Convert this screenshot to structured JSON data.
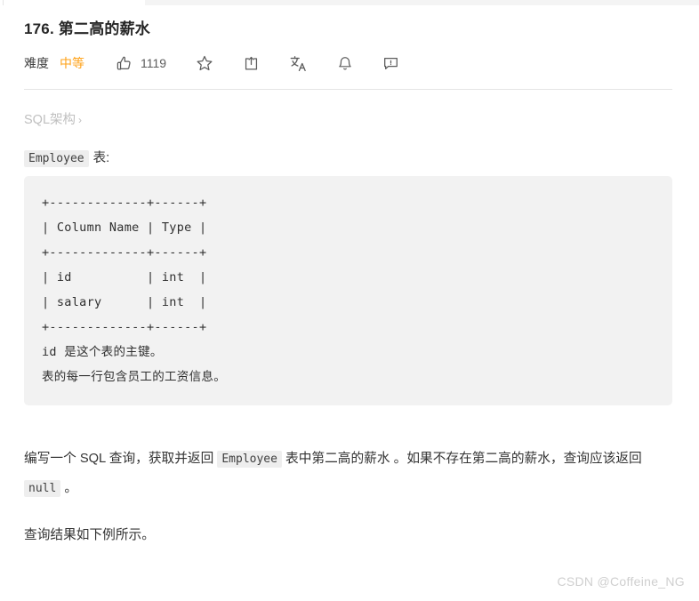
{
  "problem": {
    "title": "176. 第二高的薪水",
    "difficulty_label": "难度",
    "difficulty_value": "中等",
    "difficulty_color": "#ffa116"
  },
  "actions": {
    "like": {
      "icon": "thumbs-up-icon",
      "count": "1119"
    },
    "favorite": {
      "icon": "star-icon"
    },
    "share": {
      "icon": "share-icon"
    },
    "translate": {
      "icon": "translate-icon"
    },
    "notify": {
      "icon": "bell-icon"
    },
    "feedback": {
      "icon": "feedback-icon"
    }
  },
  "breadcrumb": {
    "label": "SQL架构",
    "chevron": "›"
  },
  "schema": {
    "code_name": "Employee",
    "caption_suffix": "表:",
    "ascii_table": "+-------------+------+\n| Column Name | Type |\n+-------------+------+\n| id          | int  |\n| salary      | int  |\n+-------------+------+",
    "notes": [
      "id 是这个表的主键。",
      "表的每一行包含员工的工资信息。"
    ]
  },
  "description": {
    "part1": "编写一个 SQL 查询，获取并返回 ",
    "code1": "Employee",
    "part2": " 表中第二高的薪水 。如果不存在第二高的薪水，查询应该返回 ",
    "code2": "null",
    "part3": " 。",
    "part4": "查询结果如下例所示。"
  },
  "watermark": "CSDN @Coffeine_NG"
}
